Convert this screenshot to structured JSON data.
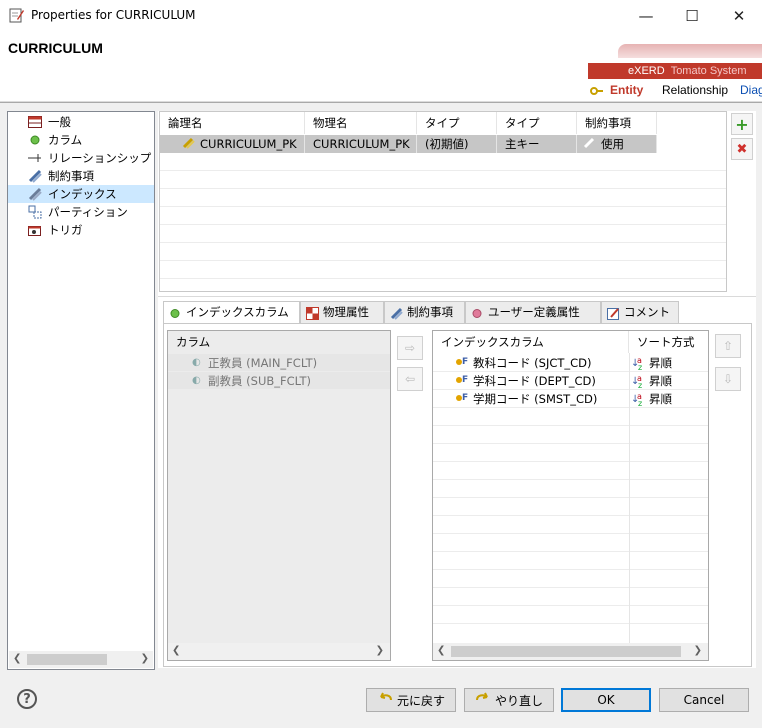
{
  "window": {
    "title": "Properties for CURRICULUM",
    "minimize": "—",
    "maximize": "☐",
    "close": "✕"
  },
  "header": {
    "title": "CURRICULUM"
  },
  "banner": {
    "brand": "eXERD",
    "brand_sub": "Tomato System",
    "tabs": [
      "Entity",
      "Relationship",
      "Diag"
    ]
  },
  "tree": {
    "items": [
      {
        "label": "一般",
        "icon": "table-icon"
      },
      {
        "label": "カラム",
        "icon": "column-dot-icon"
      },
      {
        "label": "リレーションシップ",
        "icon": "relationship-arrow-icon"
      },
      {
        "label": "制約事項",
        "icon": "constraint-icon"
      },
      {
        "label": "インデックス",
        "icon": "index-icon",
        "selected": true
      },
      {
        "label": "パーティション",
        "icon": "partition-icon"
      },
      {
        "label": "トリガ",
        "icon": "trigger-icon"
      }
    ]
  },
  "index_table": {
    "headers": [
      "論理名",
      "物理名",
      "タイプ",
      "タイプ",
      "制約事項"
    ],
    "rows": [
      {
        "logical": "CURRICULUM_PK",
        "physical": "CURRICULUM_PK",
        "type1": "(初期値)",
        "type2": "主キー",
        "constraint": "使用"
      }
    ]
  },
  "side_buttons": {
    "add": "+",
    "remove": "✖"
  },
  "tabs": [
    {
      "label": "インデックスカラム",
      "icon": "green-dot-icon",
      "active": true
    },
    {
      "label": "物理属性",
      "icon": "physical-icon"
    },
    {
      "label": "制約事項",
      "icon": "constraint-icon"
    },
    {
      "label": "ユーザー定義属性",
      "icon": "pink-dot-icon"
    },
    {
      "label": "コメント",
      "icon": "comment-icon"
    }
  ],
  "columns_list": {
    "header": "カラム",
    "items": [
      "正教員 (MAIN_FCLT)",
      "副教員 (SUB_FCLT)"
    ]
  },
  "index_columns": {
    "headers": [
      "インデックスカラム",
      "ソート方式"
    ],
    "rows": [
      {
        "column": "教科コード (SJCT_CD)",
        "sort": "昇順"
      },
      {
        "column": "学科コード (DEPT_CD)",
        "sort": "昇順"
      },
      {
        "column": "学期コード (SMST_CD)",
        "sort": "昇順"
      }
    ]
  },
  "footer": {
    "undo": "元に戻す",
    "redo": "やり直し",
    "ok": "OK",
    "cancel": "Cancel",
    "help": "?"
  },
  "colors": {
    "accent": "#0078d7",
    "banner": "#c0392b",
    "selection": "#cce8ff"
  }
}
